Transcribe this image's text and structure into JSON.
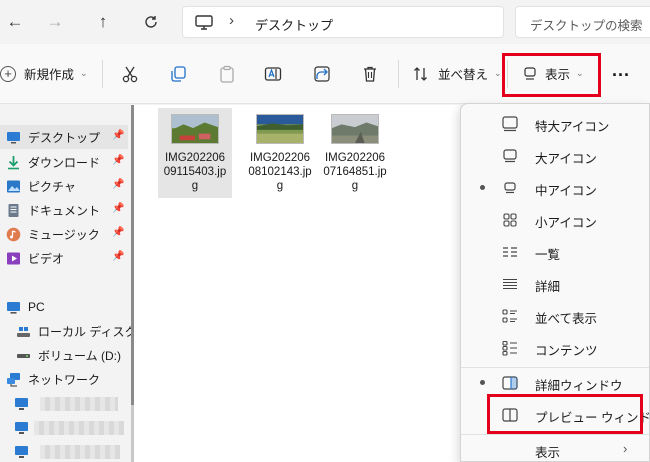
{
  "address_bar": {
    "back_icon": "arrow-left-icon",
    "forward_icon": "arrow-right-icon",
    "up_icon": "arrow-up-icon",
    "refresh_icon": "refresh-icon",
    "breadcrumb_location": "デスクトップ",
    "search_placeholder": "デスクトップの検索"
  },
  "command_bar": {
    "new_label": "新規作成",
    "sort_label": "並べ替え",
    "view_label": "表示",
    "more_label": "...",
    "icons": [
      "cut-icon",
      "copy-icon",
      "paste-icon",
      "rename-icon",
      "share-icon",
      "delete-icon"
    ]
  },
  "sidebar": {
    "quick_access": [
      {
        "label": "デスクトップ",
        "icon": "desktop-icon",
        "selected": true
      },
      {
        "label": "ダウンロード",
        "icon": "download-icon"
      },
      {
        "label": "ピクチャ",
        "icon": "pictures-icon"
      },
      {
        "label": "ドキュメント",
        "icon": "documents-icon"
      },
      {
        "label": "ミュージック",
        "icon": "music-icon"
      },
      {
        "label": "ビデオ",
        "icon": "video-icon"
      }
    ],
    "pc_label": "PC",
    "drives": [
      {
        "label": "ローカル ディスク (C:",
        "icon": "local-disk-icon"
      },
      {
        "label": "ボリューム (D:)",
        "icon": "volume-icon"
      }
    ],
    "network_label": "ネットワーク",
    "pin_icon": "pin-icon"
  },
  "files": [
    {
      "name_line1": "IMG202206",
      "name_line2": "09115403.jp",
      "name_line3": "g",
      "selected": true
    },
    {
      "name_line1": "IMG202206",
      "name_line2": "08102143.jp",
      "name_line3": "g"
    },
    {
      "name_line1": "IMG202206",
      "name_line2": "07164851.jp",
      "name_line3": "g"
    }
  ],
  "view_menu": {
    "items": [
      {
        "label": "特大アイコン",
        "icon": "extra-large-icons-icon"
      },
      {
        "label": "大アイコン",
        "icon": "large-icons-icon"
      },
      {
        "label": "中アイコン",
        "icon": "medium-icons-icon",
        "checked": true
      },
      {
        "label": "小アイコン",
        "icon": "small-icons-icon"
      },
      {
        "label": "一覧",
        "icon": "list-icon"
      },
      {
        "label": "詳細",
        "icon": "details-icon"
      },
      {
        "label": "並べて表示",
        "icon": "tiles-icon"
      },
      {
        "label": "コンテンツ",
        "icon": "content-icon"
      }
    ],
    "pane_items": [
      {
        "label": "詳細ウィンドウ",
        "icon": "details-pane-icon",
        "checked": true
      },
      {
        "label": "プレビュー ウィンドウ",
        "icon": "preview-pane-icon"
      }
    ],
    "show_label": "表示"
  },
  "colors": {
    "highlight_box": "#e3001b",
    "selection": "#e5e5e5"
  }
}
